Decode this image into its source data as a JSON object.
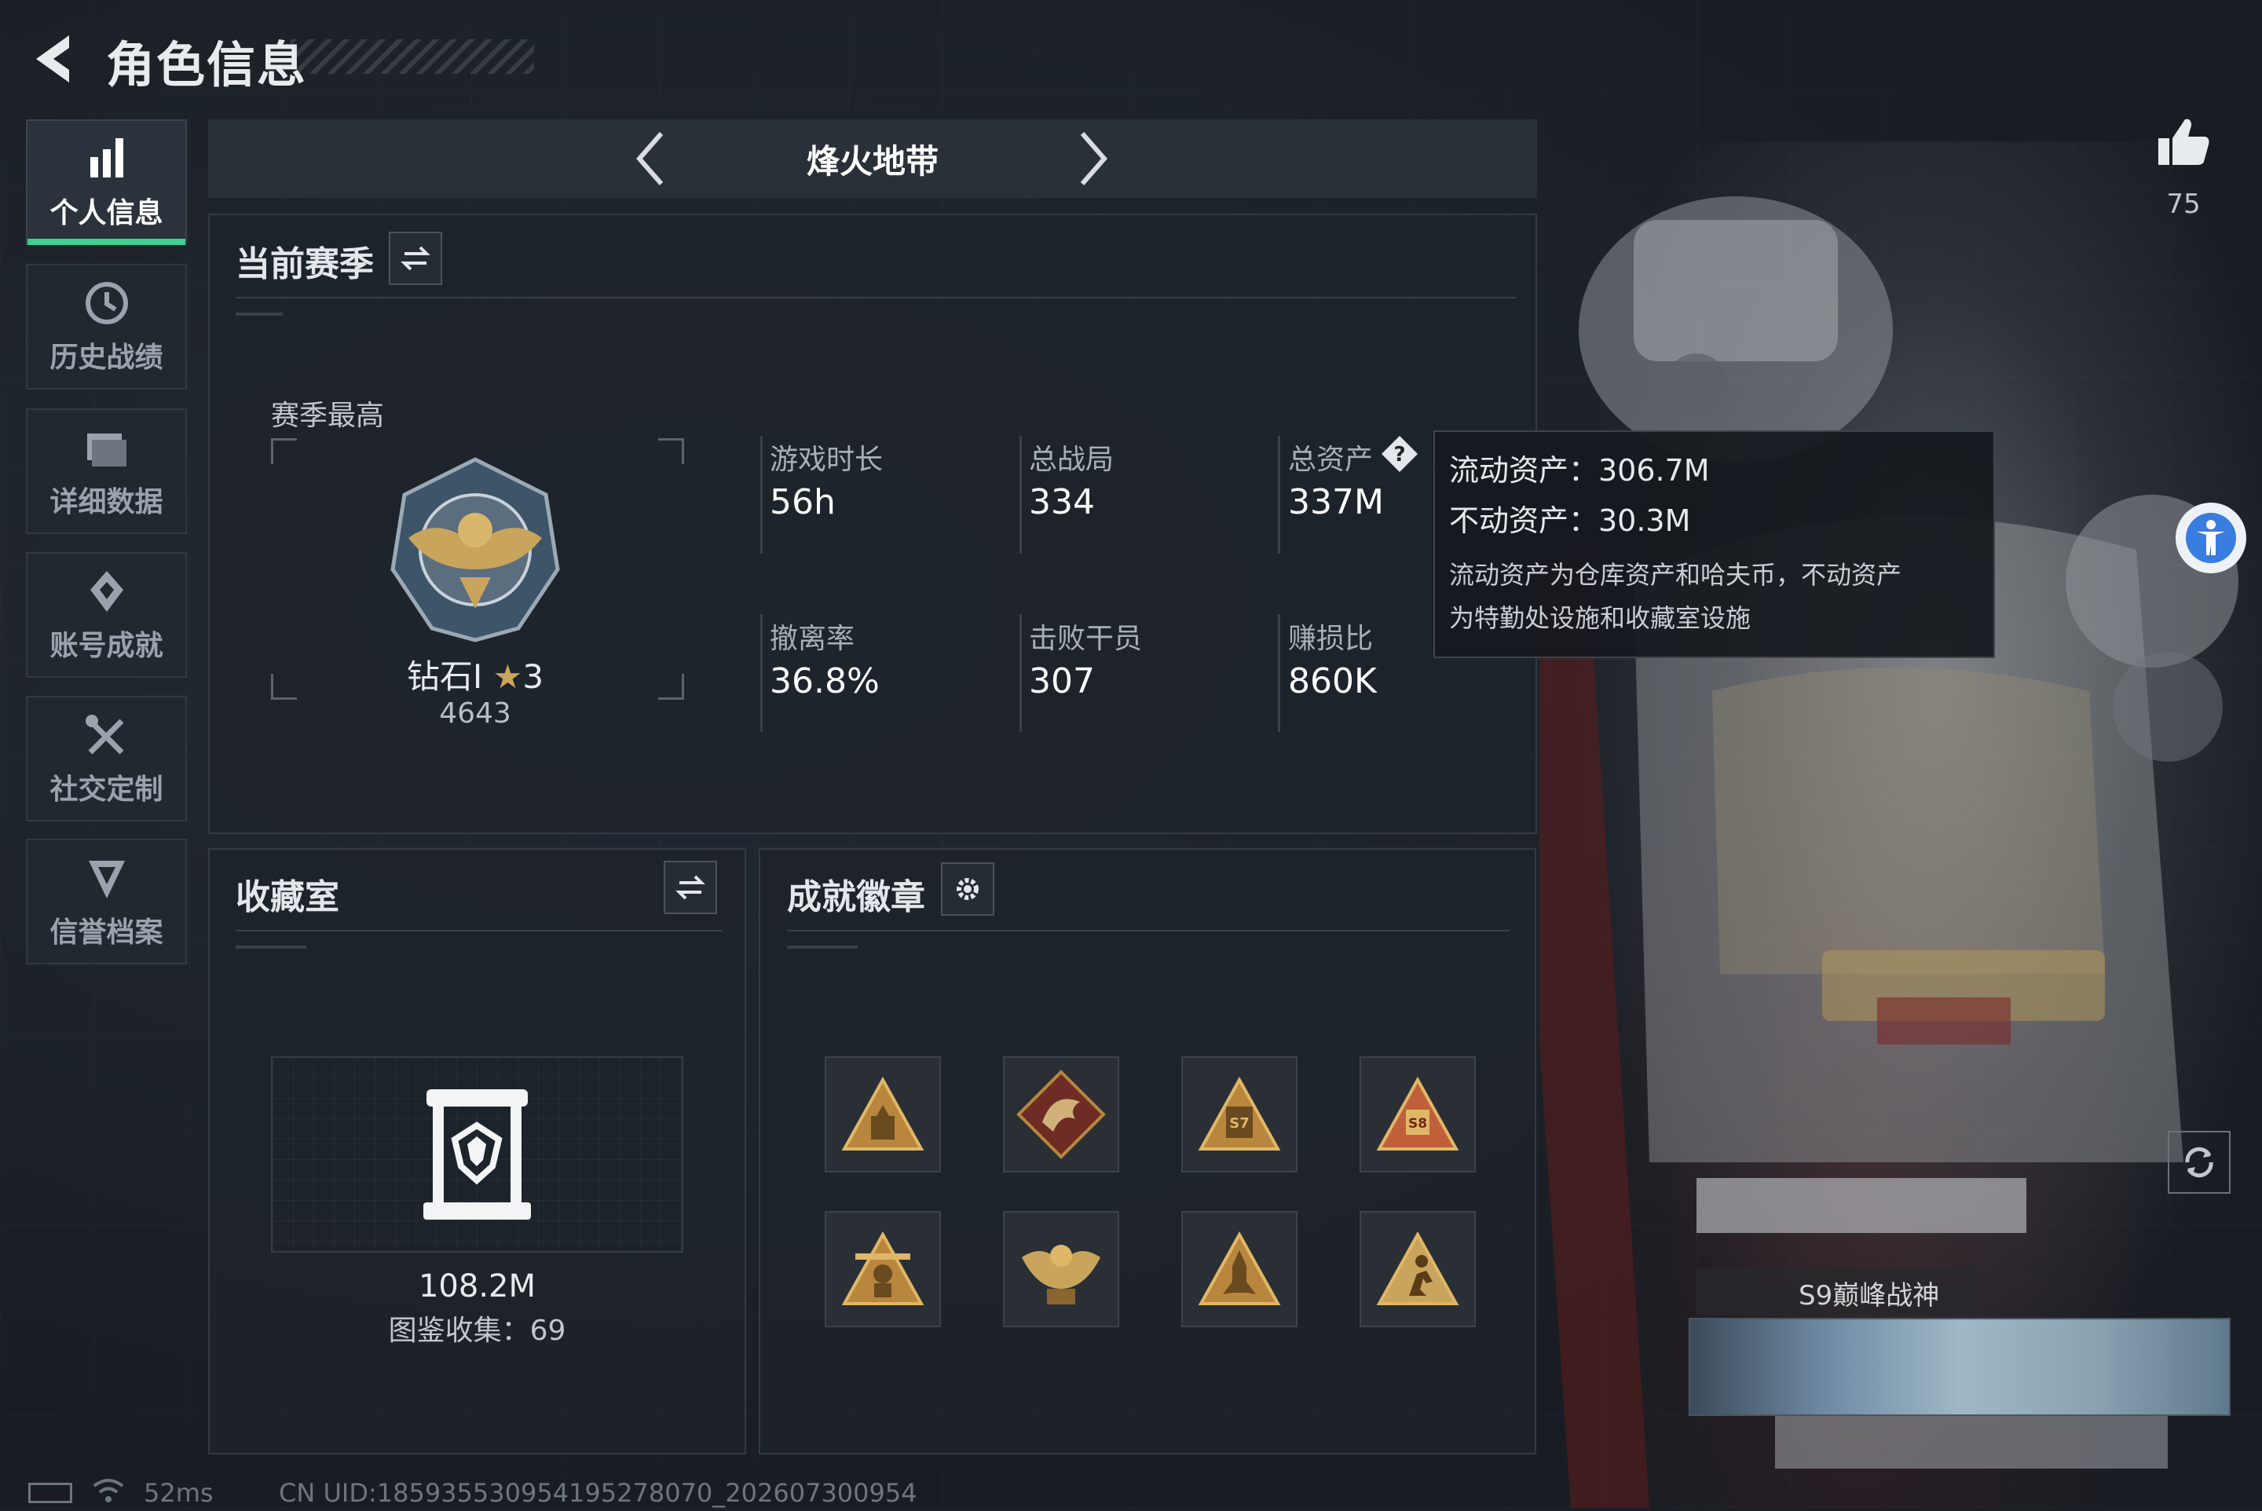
{
  "header": {
    "title": "角色信息"
  },
  "nav": [
    {
      "label": "个人信息",
      "icon": "bar-chart-icon",
      "active": true
    },
    {
      "label": "历史战绩",
      "icon": "history-clock-icon",
      "active": false
    },
    {
      "label": "详细数据",
      "icon": "folder-icon",
      "active": false
    },
    {
      "label": "账号成就",
      "icon": "achievement-icon",
      "active": false
    },
    {
      "label": "社交定制",
      "icon": "tools-icon",
      "active": false
    },
    {
      "label": "信誉档案",
      "icon": "reputation-shield-icon",
      "active": false
    }
  ],
  "mode": {
    "title": "烽火地带"
  },
  "likes": {
    "count": "75"
  },
  "season": {
    "title": "当前赛季",
    "best_label": "赛季最高",
    "rank_name": "钻石I",
    "rank_stars": "3",
    "rank_score": "4643",
    "stats": [
      {
        "label": "游戏时长",
        "value": "56h"
      },
      {
        "label": "总战局",
        "value": "334"
      },
      {
        "label": "总资产",
        "value": "337M"
      },
      {
        "label": "撤离率",
        "value": "36.8%"
      },
      {
        "label": "击败干员",
        "value": "307"
      },
      {
        "label": "赚损比",
        "value": "860K"
      }
    ]
  },
  "tooltip": {
    "liquid": "流动资产：306.7M",
    "fixed": "不动资产：30.3M",
    "desc_line1": "流动资产为仓库资产和哈夫币，不动资产",
    "desc_line2": "为特勤处设施和收藏室设施"
  },
  "collection": {
    "title": "收藏室",
    "value": "108.2M",
    "count_text": "图鉴收集：69"
  },
  "achievements": {
    "title": "成就徽章",
    "badges": [
      "badge-pyramid",
      "badge-dragon",
      "badge-s7",
      "badge-s8",
      "badge-soldier",
      "badge-eagle",
      "badge-rocket",
      "badge-runner"
    ]
  },
  "banner": {
    "text": "S9巅峰战神"
  },
  "status": {
    "ping": "52ms",
    "uid": "CN UID:185935530954195278070_202607300954"
  },
  "colors": {
    "accent_green": "#3fcf8e",
    "gold": "#c9a45c",
    "background": "#1b2027"
  }
}
